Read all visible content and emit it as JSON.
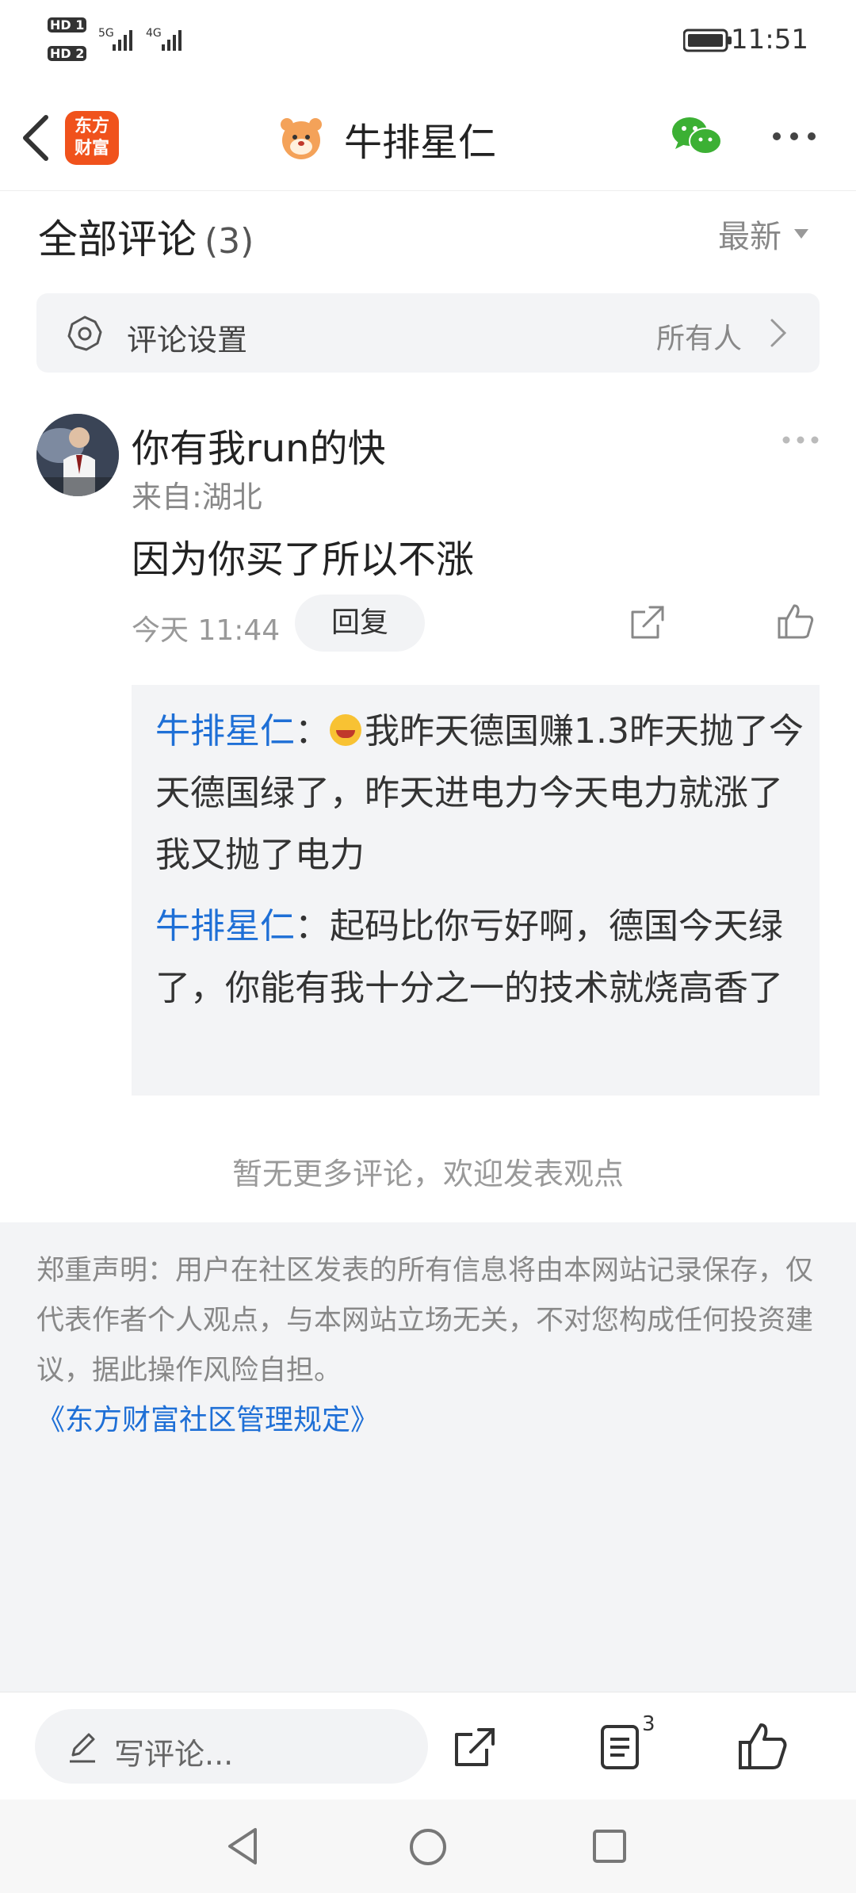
{
  "status_bar": {
    "sim1": "HD 1",
    "sim2": "HD 2",
    "network1": "5G",
    "network2": "4G",
    "time": "11:51"
  },
  "header": {
    "logo_text_line1": "东方",
    "logo_text_line2": "财富",
    "title": "牛排星仁",
    "back_icon": "chevron-left-icon",
    "share_icon": "wechat-icon",
    "more_icon": "more-dots-icon"
  },
  "comments_section": {
    "title": "全部评论",
    "count": "(3)",
    "sort_label": "最新"
  },
  "settings": {
    "label": "评论设置",
    "value": "所有人"
  },
  "comment": {
    "author": "你有我run的快",
    "location": "来自:湖北",
    "text": "因为你买了所以不涨",
    "time": "今天 11:44",
    "reply_label": "回复",
    "replies": [
      {
        "author": "牛排星仁",
        "colon": "：",
        "text": "我昨天德国赚1.3昨天抛了今天德国绿了，昨天进电力今天电力就涨了我又抛了电力"
      },
      {
        "author": "牛排星仁",
        "colon": "：",
        "text": "起码比你亏好啊，德国今天绿了，你能有我十分之一的技术就烧高香了"
      }
    ]
  },
  "no_more": "暂无更多评论，欢迎发表观点",
  "disclaimer": {
    "text": "郑重声明：用户在社区发表的所有信息将由本网站记录保存，仅代表作者个人观点，与本网站立场无关，不对您构成任何投资建议，据此操作风险自担。",
    "link": "《东方财富社区管理规定》"
  },
  "bottom_bar": {
    "write_placeholder": "写评论...",
    "comment_count": "3"
  },
  "colors": {
    "accent_blue": "#1e6fd6",
    "brand_orange": "#f0521c",
    "wechat_green": "#3cb034"
  }
}
